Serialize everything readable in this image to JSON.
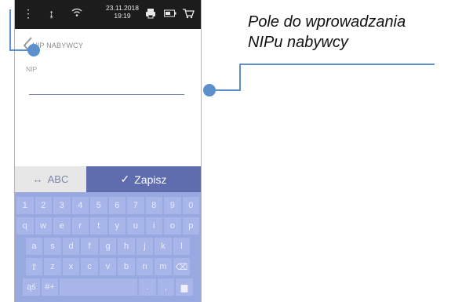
{
  "status_bar": {
    "date": "23.11.2018",
    "time": "19:19"
  },
  "screen": {
    "title": "NIP NABYWCY",
    "field_label": "NIP",
    "field_value": ""
  },
  "actions": {
    "abc_label": "ABC",
    "save_label": "Zapisz"
  },
  "keyboard": {
    "row1": [
      "1",
      "2",
      "3",
      "4",
      "5",
      "6",
      "7",
      "8",
      "9",
      "0"
    ],
    "row2": [
      "q",
      "w",
      "e",
      "r",
      "t",
      "y",
      "u",
      "i",
      "o",
      "p"
    ],
    "row3": [
      "a",
      "s",
      "d",
      "f",
      "g",
      "h",
      "j",
      "k",
      "l"
    ],
    "row4": [
      "z",
      "x",
      "c",
      "v",
      "b",
      "n",
      "m"
    ],
    "row5": [
      "ąś",
      "#+",
      ".",
      ","
    ]
  },
  "callout": {
    "line1": "Pole do wprowadzania",
    "line2": "NIPu nabywcy"
  },
  "colors": {
    "accent": "#5f6cae",
    "keyboard_bg": "#98a9e2",
    "callout": "#5b90cc"
  }
}
